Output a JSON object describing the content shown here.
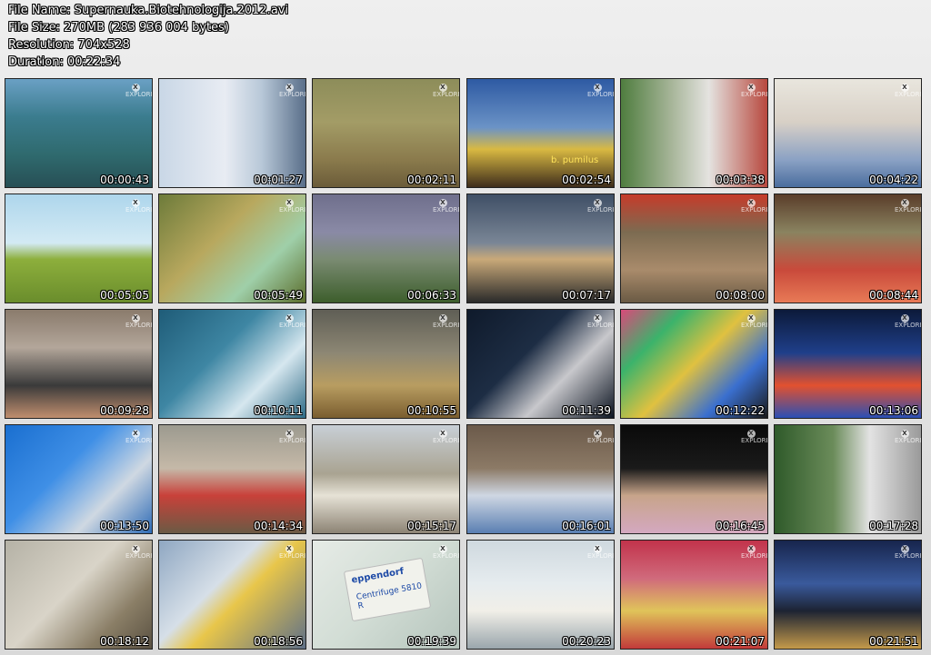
{
  "info": {
    "file_name": "File Name: Supernauka.Biotehnologija.2012.avi",
    "file_size": "File Size: 270MB (283 936 004 bytes)",
    "resolution": "Resolution: 704x528",
    "duration": "Duration: 00:22:34"
  },
  "watermark_text": "EXPLORER",
  "thumbnails": [
    {
      "time": "00:00:43",
      "bg": "linear-gradient(180deg,#6aa0c4 0%,#3b7c8e 35%,#2f6a6e 70%,#274f55 100%)"
    },
    {
      "time": "00:01:27",
      "bg": "linear-gradient(90deg,#c9d7e6 0%,#e8ecf3 45%,#b8c8d8 70%,#5a6f8a 100%)"
    },
    {
      "time": "00:02:11",
      "bg": "linear-gradient(180deg,#8d8d5a 0%,#a39c66 40%,#8a7a4c 75%,#6b5c39 100%)"
    },
    {
      "time": "00:02:54",
      "bg": "linear-gradient(180deg,#2e5aa3 0%,#6b93c6 45%,#d9b942 65%,#3e2d1c 100%)",
      "text": "b. pumilus"
    },
    {
      "time": "00:03:38",
      "bg": "linear-gradient(90deg,#4f7d3f 0%,#a8b69a 35%,#e4e3e0 60%,#b8483e 100%)"
    },
    {
      "time": "00:04:22",
      "bg": "linear-gradient(180deg,#e9e6de 0%,#d8d0c6 40%,#8aa1c4 75%,#4a6d9e 100%)"
    },
    {
      "time": "00:05:05",
      "bg": "linear-gradient(180deg,#aed6ec 0%,#d3eaf4 45%,#8daf3c 60%,#6a8d2c 100%)"
    },
    {
      "time": "00:05:49",
      "bg": "linear-gradient(135deg,#6d7b3a 0%,#b8a85e 40%,#9fcfa9 70%,#5b6d2b 100%)"
    },
    {
      "time": "00:06:33",
      "bg": "linear-gradient(180deg,#6f6f8c 0%,#8a8aa6 35%,#7a8b72 60%,#3d5e2c 100%)"
    },
    {
      "time": "00:07:17",
      "bg": "linear-gradient(180deg,#3f4f66 0%,#7a8696 45%,#c9a979 60%,#2a2a2a 100%)"
    },
    {
      "time": "00:08:00",
      "bg": "linear-gradient(180deg,#c63b2a 0%,#7c6b51 35%,#a98b6b 70%,#6a5a44 100%)"
    },
    {
      "time": "00:08:44",
      "bg": "linear-gradient(180deg,#5a3d2a 0%,#8a8360 35%,#c94a3b 70%,#e87a56 100%)"
    },
    {
      "time": "00:09:28",
      "bg": "linear-gradient(180deg,#8a7b6c 0%,#b3a69a 35%,#3a3a3a 70%,#c08e6e 100%)"
    },
    {
      "time": "00:10:11",
      "bg": "linear-gradient(135deg,#1f5c78 0%,#3e86a3 40%,#d6e7ef 70%,#2d6a85 100%)"
    },
    {
      "time": "00:10:55",
      "bg": "linear-gradient(180deg,#5f5e55 0%,#8d8774 40%,#b89d61 70%,#7a5d2f 100%)"
    },
    {
      "time": "00:11:39",
      "bg": "linear-gradient(135deg,#0f1a2b 0%,#1d2d44 40%,#c8c8cc 65%,#0d1522 100%)"
    },
    {
      "time": "00:12:22",
      "bg": "linear-gradient(135deg,#d94a7a 0%,#3bb36b 25%,#e0c140 50%,#3a6fcf 75%,#1a1a1a 100%)"
    },
    {
      "time": "00:13:06",
      "bg": "linear-gradient(180deg,#0c1a3a 0%,#1f3f8a 40%,#e2512f 70%,#2a4fb5 100%)"
    },
    {
      "time": "00:13:50",
      "bg": "linear-gradient(135deg,#1a6fd0 0%,#3f8fe6 40%,#cfd8e2 70%,#2e6bb6 100%)"
    },
    {
      "time": "00:14:34",
      "bg": "linear-gradient(180deg,#9c9a8f 0%,#c5b9a8 40%,#c8413a 65%,#6b5a44 100%)"
    },
    {
      "time": "00:15:17",
      "bg": "linear-gradient(180deg,#c8cfd6 0%,#a9a391 45%,#e6e2d6 65%,#8c8374 100%)"
    },
    {
      "time": "00:16:01",
      "bg": "linear-gradient(180deg,#6b5a4a 0%,#8c7a66 40%,#cfd7e3 65%,#5a7fb2 100%)"
    },
    {
      "time": "00:16:45",
      "bg": "linear-gradient(180deg,#0a0a0a 0%,#1a1a1a 40%,#c7a48a 65%,#d4a8c0 100%)"
    },
    {
      "time": "00:17:28",
      "bg": "linear-gradient(90deg,#2f5a2a 0%,#6b8c5a 40%,#e3e3e3 65%,#9a9a9a 100%)"
    },
    {
      "time": "00:18:12",
      "bg": "linear-gradient(135deg,#b5b2a6 0%,#d9d4c8 45%,#8a7e66 75%,#5a5142 100%)"
    },
    {
      "time": "00:18:56",
      "bg": "linear-gradient(135deg,#8fa7c2 0%,#d6dfe8 40%,#e8c64a 55%,#5f7088 100%)"
    },
    {
      "time": "00:19:39",
      "bg": "linear-gradient(135deg,#e6ebe6 0%,#d2ddd5 50%,#b5c4bc 100%)",
      "brand": "eppendorf",
      "model": "Centrifuge 5810 R"
    },
    {
      "time": "00:20:23",
      "bg": "linear-gradient(180deg,#cfd9df 0%,#e6ecef 40%,#f1efe8 65%,#9aa6ac 100%)"
    },
    {
      "time": "00:21:07",
      "bg": "linear-gradient(180deg,#c2334b 0%,#d06a7c 35%,#e0c45a 65%,#c23a3a 100%)"
    },
    {
      "time": "00:21:51",
      "bg": "linear-gradient(180deg,#17254d 0%,#3a5a9c 40%,#1c2333 65%,#c49a4a 100%)"
    }
  ]
}
